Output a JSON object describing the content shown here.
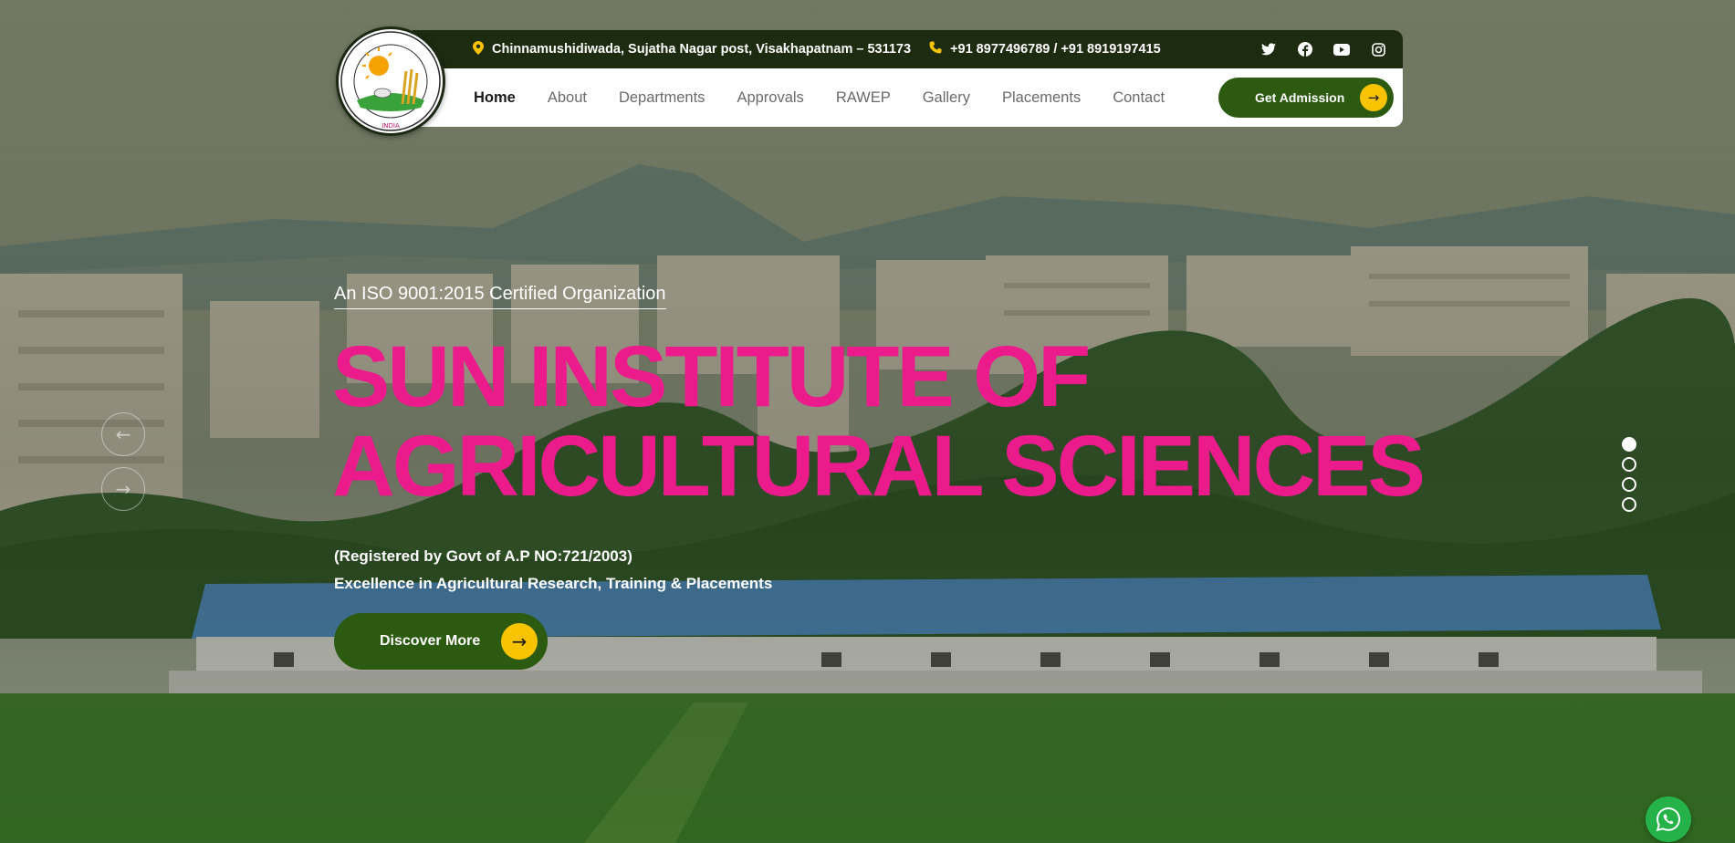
{
  "header": {
    "logo_alt": "SUN INSTITUTE OF AGRICULTURAL SCIENCES (A.P) INDIA",
    "address": "Chinnamushidiwada, Sujatha Nagar post, Visakhapatnam – 531173",
    "phone": "+91 8977496789 / +91 8919197415",
    "socials": [
      "twitter-icon",
      "facebook-icon",
      "youtube-icon",
      "instagram-icon"
    ],
    "nav": [
      {
        "label": "Home",
        "active": true
      },
      {
        "label": "About",
        "active": false
      },
      {
        "label": "Departments",
        "active": false
      },
      {
        "label": "Approvals",
        "active": false
      },
      {
        "label": "RAWEP",
        "active": false
      },
      {
        "label": "Gallery",
        "active": false
      },
      {
        "label": "Placements",
        "active": false
      },
      {
        "label": "Contact",
        "active": false
      }
    ],
    "cta_label": "Get Admission"
  },
  "hero": {
    "certification": "An ISO 9001:2015 Certified Organization",
    "title_line1": "SUN INSTITUTE OF",
    "title_line2": "AGRICULTURAL SCIENCES",
    "registration": "(Registered by Govt of A.P NO:721/2003)",
    "tagline": "Excellence in Agricultural Research, Training & Placements",
    "button_label": "Discover More",
    "slides_total": 4,
    "active_slide": 1
  },
  "colors": {
    "brand_green": "#2b5a10",
    "topbar_dark": "#1d2b10",
    "accent_yellow": "#f8c300",
    "title_pink": "#ec1b8c",
    "whatsapp_green": "#25b349"
  }
}
